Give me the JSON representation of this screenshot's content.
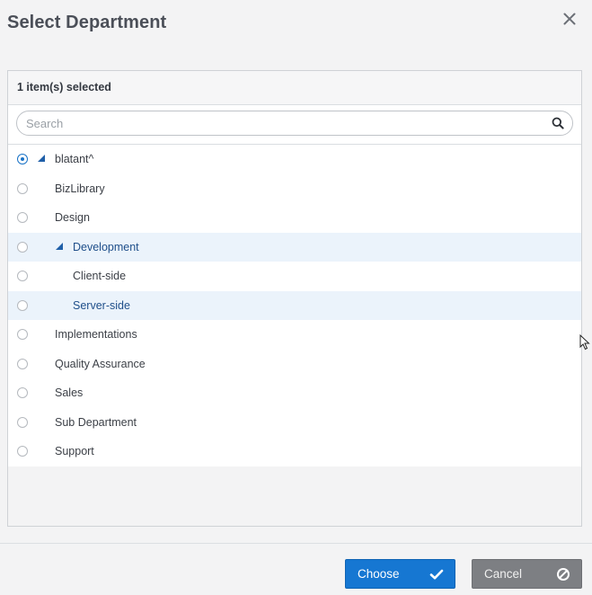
{
  "dialog": {
    "title": "Select Department",
    "close_icon": "close-icon"
  },
  "panel": {
    "selection_summary": "1 item(s) selected",
    "search": {
      "placeholder": "Search",
      "value": "",
      "icon": "search-icon"
    },
    "tree": [
      {
        "label": "blatant^",
        "selected": true,
        "expanded": true,
        "depth": 0,
        "highlighted": false
      },
      {
        "label": "BizLibrary",
        "selected": false,
        "depth": 1,
        "highlighted": false
      },
      {
        "label": "Design",
        "selected": false,
        "depth": 1,
        "highlighted": false
      },
      {
        "label": "Development",
        "selected": false,
        "expanded": true,
        "depth": 1,
        "highlighted": true
      },
      {
        "label": "Client-side",
        "selected": false,
        "depth": 2,
        "highlighted": false
      },
      {
        "label": "Server-side",
        "selected": false,
        "depth": 2,
        "highlighted": true
      },
      {
        "label": "Implementations",
        "selected": false,
        "depth": 1,
        "highlighted": false
      },
      {
        "label": "Quality Assurance",
        "selected": false,
        "depth": 1,
        "highlighted": false
      },
      {
        "label": "Sales",
        "selected": false,
        "depth": 1,
        "highlighted": false
      },
      {
        "label": "Sub Department",
        "selected": false,
        "depth": 1,
        "highlighted": false
      },
      {
        "label": "Support",
        "selected": false,
        "depth": 1,
        "highlighted": false
      }
    ]
  },
  "footer": {
    "choose_label": "Choose",
    "choose_icon": "checkmark-icon",
    "cancel_label": "Cancel",
    "cancel_icon": "cancel-circle-icon"
  },
  "colors": {
    "primary": "#1677d2",
    "secondary_button": "#7d7f83",
    "highlight_row": "#ebf3fb",
    "tree_toggle": "#1f5fa8"
  }
}
